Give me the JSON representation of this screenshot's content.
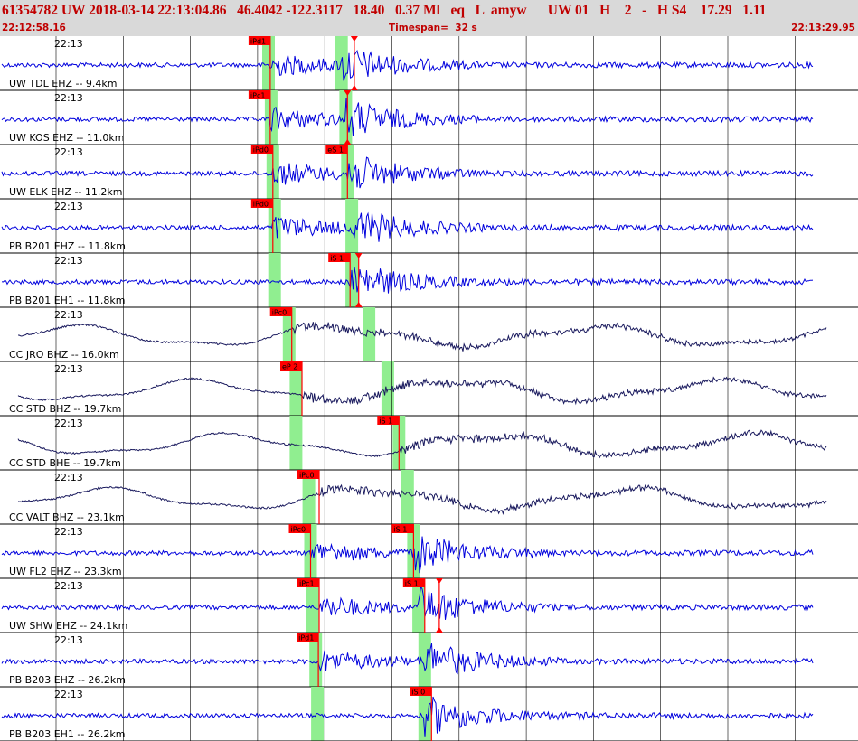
{
  "header": {
    "title": "61354782 UW 2018-03-14 22:13:04.86   46.4042 -122.3117   18.40   0.37 Ml   eq   L  amyw      UW 01   H    2   -   H S4    17.29   1.11",
    "start_time": "22:12:58.16",
    "timespan": "Timespan=  32 s",
    "end_time": "22:13:29.95"
  },
  "colors": {
    "header_background": "#d9d9d9",
    "header_text": "#c00000",
    "trace_blue": "#0000dd",
    "trace_dark": "#1a1a5e",
    "pick_window": "#90ee90",
    "pick_flag": "#ff0000"
  },
  "time_label": "22:13",
  "traces": [
    {
      "label": "UW TDL EHZ -- 9.4km",
      "color": "blue",
      "freq": "high",
      "picks": [
        {
          "label": "iPd1",
          "pos": 0.315
        },
        {
          "label": "",
          "pos": 0.413,
          "triangle": true
        }
      ],
      "green": [
        0.313,
        0.398
      ]
    },
    {
      "label": "UW KOS EHZ -- 11.0km",
      "color": "blue",
      "freq": "high",
      "picks": [
        {
          "label": "iPc1",
          "pos": 0.315
        },
        {
          "label": "",
          "pos": 0.405,
          "triangle": true
        }
      ],
      "green": [
        0.316,
        0.403
      ]
    },
    {
      "label": "UW ELK EHZ -- 11.2km",
      "color": "blue",
      "freq": "high",
      "picks": [
        {
          "label": "iPd0",
          "pos": 0.318
        },
        {
          "label": "eS 1",
          "pos": 0.405
        }
      ],
      "green": [
        0.318,
        0.405
      ]
    },
    {
      "label": "PB B201 EHZ -- 11.8km",
      "color": "blue",
      "freq": "high",
      "picks": [
        {
          "label": "iPd0",
          "pos": 0.318
        }
      ],
      "green": [
        0.32,
        0.41
      ]
    },
    {
      "label": "PB B201 EH1 -- 11.8km",
      "color": "blue",
      "freq": "high",
      "picks": [
        {
          "label": "iS 1",
          "pos": 0.408
        },
        {
          "label": "",
          "pos": 0.418,
          "triangle": true
        }
      ],
      "green": [
        0.32,
        0.41
      ]
    },
    {
      "label": "CC JRO BHZ -- 16.0km",
      "color": "dark",
      "freq": "low",
      "picks": [
        {
          "label": "iPc0",
          "pos": 0.34
        }
      ],
      "green": [
        0.337,
        0.43
      ]
    },
    {
      "label": "CC STD BHZ -- 19.7km",
      "color": "dark",
      "freq": "low",
      "picks": [
        {
          "label": "eP 2",
          "pos": 0.352
        }
      ],
      "green": [
        0.345,
        0.452
      ]
    },
    {
      "label": "CC STD BHE -- 19.7km",
      "color": "dark",
      "freq": "low",
      "picks": [
        {
          "label": "iS 1",
          "pos": 0.465
        }
      ],
      "green": [
        0.345,
        0.465
      ]
    },
    {
      "label": "CC VALT BHZ -- 23.1km",
      "color": "dark",
      "freq": "low",
      "picks": [
        {
          "label": "iPc0",
          "pos": 0.372
        }
      ],
      "green": [
        0.36,
        0.475
      ]
    },
    {
      "label": "UW FL2 EHZ -- 23.3km",
      "color": "blue",
      "freq": "high",
      "picks": [
        {
          "label": "iPc0",
          "pos": 0.362
        },
        {
          "label": "iS 1",
          "pos": 0.482
        }
      ],
      "green": [
        0.362,
        0.482
      ]
    },
    {
      "label": "UW SHW EHZ -- 24.1km",
      "color": "blue",
      "freq": "high",
      "picks": [
        {
          "label": "iPc1",
          "pos": 0.372
        },
        {
          "label": "iS 1",
          "pos": 0.495
        },
        {
          "label": "",
          "pos": 0.512,
          "triangle": true
        }
      ],
      "green": [
        0.364,
        0.488
      ]
    },
    {
      "label": "PB B203 EHZ -- 26.2km",
      "color": "blue",
      "freq": "high",
      "picks": [
        {
          "label": "iPd1",
          "pos": 0.371
        }
      ],
      "green": [
        0.368,
        0.495
      ]
    },
    {
      "label": "PB B203 EH1 -- 26.2km",
      "color": "blue",
      "freq": "high",
      "picks": [
        {
          "label": "iS 0",
          "pos": 0.503
        }
      ],
      "green": [
        0.37,
        0.495
      ]
    }
  ]
}
